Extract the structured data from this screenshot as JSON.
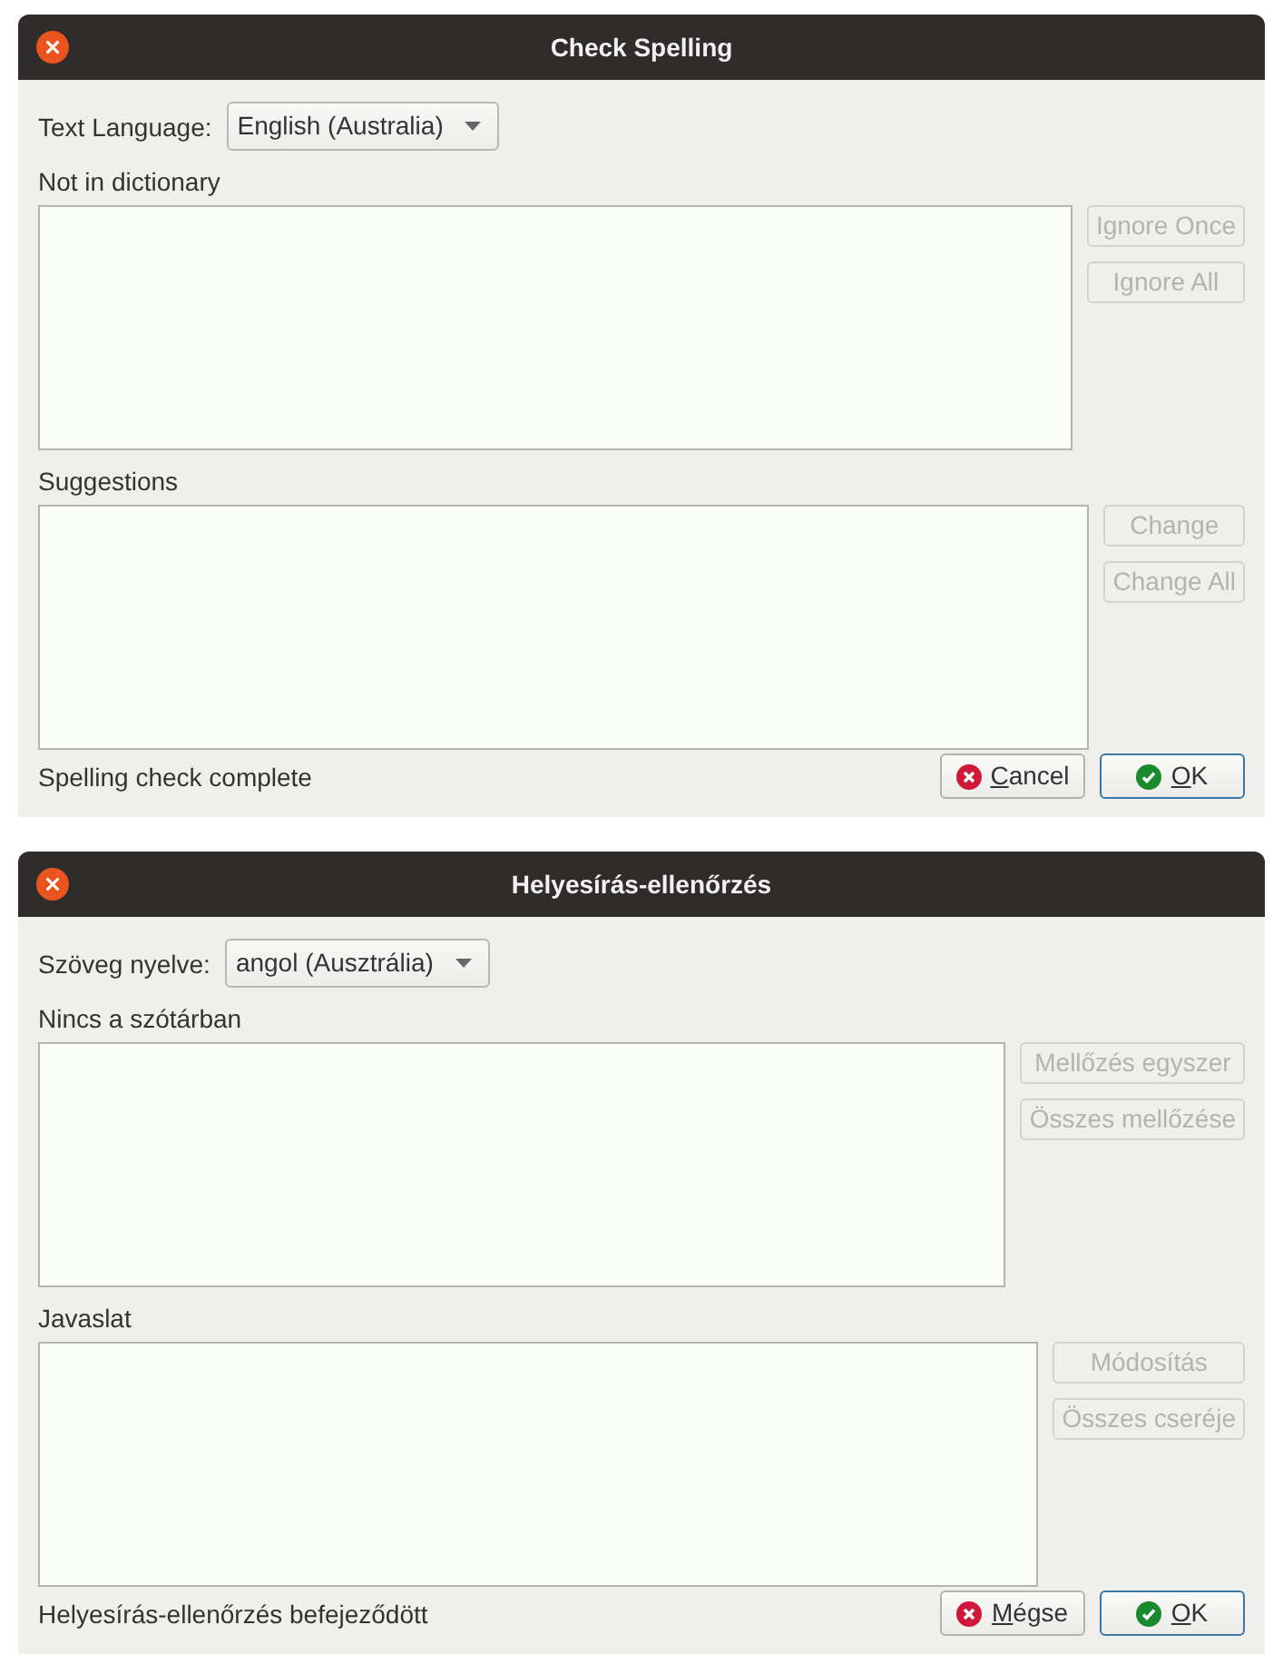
{
  "dialogs": [
    {
      "title": "Check Spelling",
      "language_label": "Text Language:",
      "language_value": "English (Australia)",
      "not_in_dictionary_label": "Not in dictionary",
      "ignore_buttons": [
        {
          "label": "Ignore Once",
          "disabled": true
        },
        {
          "label": "Ignore All",
          "disabled": true
        }
      ],
      "suggestions_label": "Suggestions",
      "change_buttons": [
        {
          "label": "Change",
          "disabled": true
        },
        {
          "label": "Change All",
          "disabled": true
        }
      ],
      "status": "Spelling check complete",
      "buttons": [
        {
          "label": "Cancel",
          "kind": "cancel",
          "mnemonic": true,
          "default": false
        },
        {
          "label": "OK",
          "kind": "ok",
          "mnemonic": true,
          "default": true
        }
      ]
    },
    {
      "title": "Helyesírás-ellenőrzés",
      "language_label": "Szöveg nyelve:",
      "language_value": "angol (Ausztrália)",
      "not_in_dictionary_label": "Nincs a szótárban",
      "ignore_buttons": [
        {
          "label": "Mellőzés egyszer",
          "disabled": true
        },
        {
          "label": "Összes mellőzése",
          "disabled": true
        }
      ],
      "suggestions_label": "Javaslat",
      "change_buttons": [
        {
          "label": "Módosítás",
          "disabled": true
        },
        {
          "label": "Összes cseréje",
          "disabled": true
        }
      ],
      "status": "Helyesírás-ellenőrzés befejeződött",
      "buttons": [
        {
          "label": "Mégse",
          "kind": "cancel",
          "mnemonic": true,
          "default": false
        },
        {
          "label": "OK",
          "kind": "ok",
          "mnemonic": true,
          "default": true
        }
      ]
    }
  ]
}
